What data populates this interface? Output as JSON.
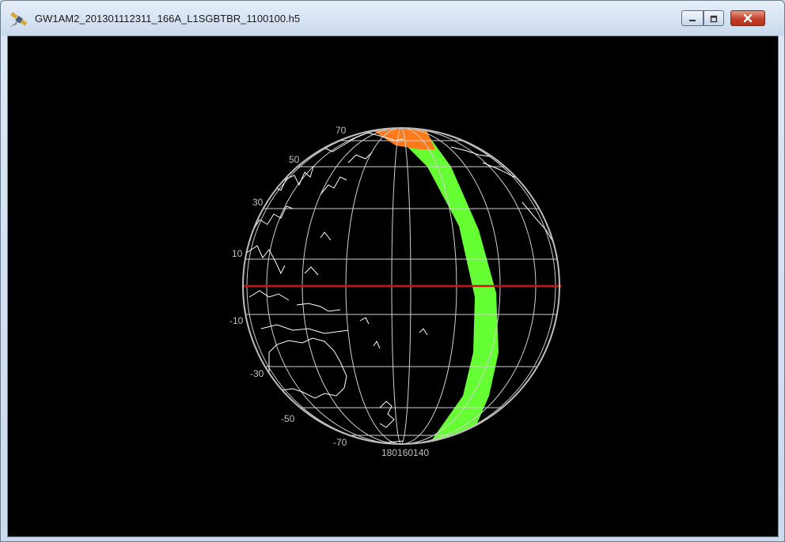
{
  "window": {
    "title": "GW1AM2_201301112311_166A_L1SGBTBR_1100100.h5",
    "icon": "satellite-icon",
    "controls": [
      {
        "name": "minimize",
        "icon": "minimize-icon"
      },
      {
        "name": "maximize",
        "icon": "maximize-icon"
      },
      {
        "name": "close",
        "icon": "close-icon"
      }
    ]
  },
  "colors": {
    "background": "#000000",
    "grid": "#d0d0d0",
    "coastline": "#ffffff",
    "equator": "#cc1111",
    "swath": "#66ff33",
    "swath_high": "#ff7a1a",
    "close_button": "#c4412a"
  },
  "globe": {
    "latitude_labels": [
      "70",
      "50",
      "30",
      "10",
      "-10",
      "-30",
      "-50",
      "-70"
    ],
    "longitude_label": "180160140"
  }
}
